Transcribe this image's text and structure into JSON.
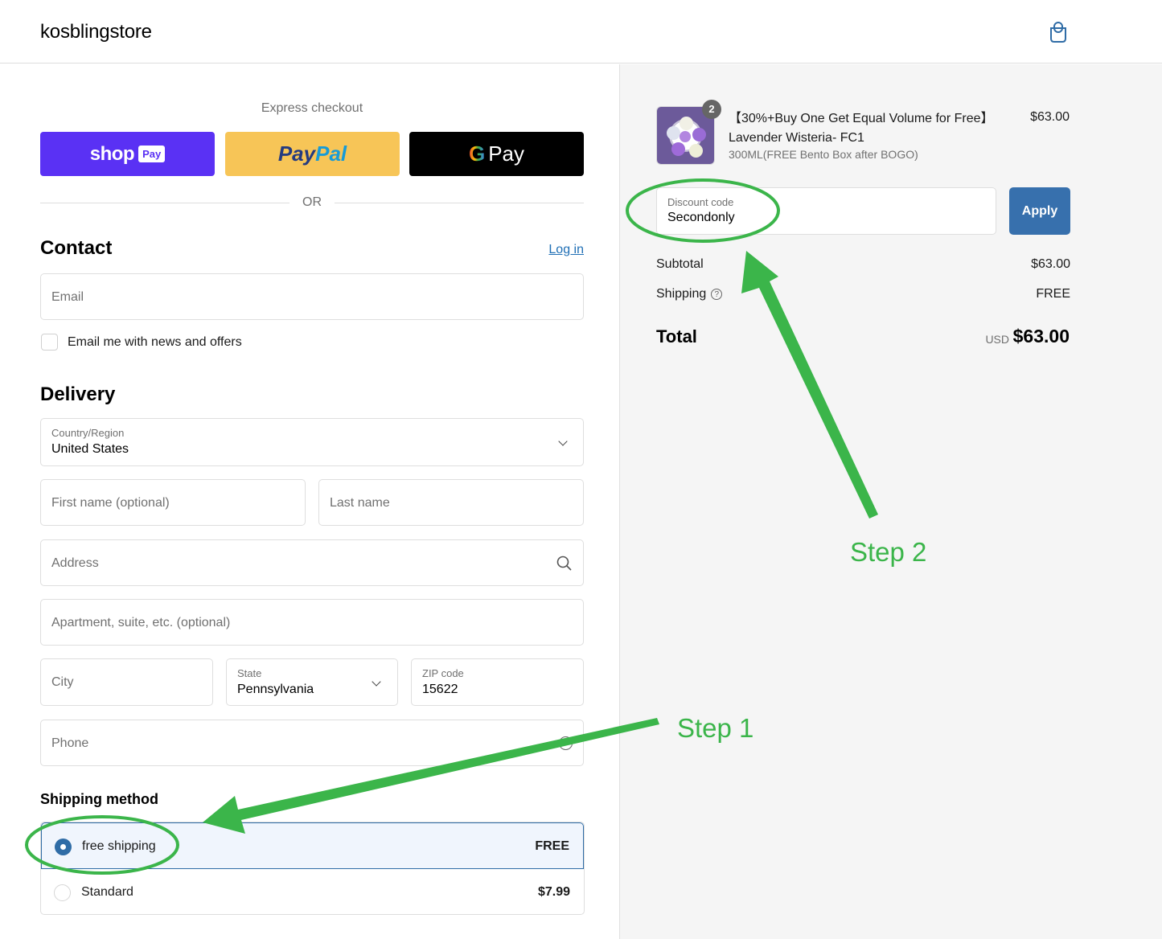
{
  "header": {
    "brand": "kosblingstore",
    "cart_icon": "shopping-bag-icon",
    "accent_color": "#2f6ca6"
  },
  "express": {
    "label": "Express checkout",
    "shop_pay": {
      "word": "shop",
      "badge": "Pay",
      "color": "#5a31f4"
    },
    "paypal": {
      "part1": "Pay",
      "part2": "Pal",
      "color": "#f7c557"
    },
    "gpay": {
      "g": "G",
      "word": "Pay",
      "color": "#000000"
    },
    "divider": "OR"
  },
  "contact": {
    "title": "Contact",
    "login_link": "Log in",
    "email": {
      "placeholder": "Email",
      "value": ""
    },
    "newsletter": {
      "label": "Email me with news and offers",
      "checked": false
    }
  },
  "delivery": {
    "title": "Delivery",
    "country": {
      "label": "Country/Region",
      "value": "United States"
    },
    "first_name": {
      "placeholder": "First name (optional)",
      "value": ""
    },
    "last_name": {
      "placeholder": "Last name",
      "value": ""
    },
    "address": {
      "placeholder": "Address",
      "value": ""
    },
    "apartment": {
      "placeholder": "Apartment, suite, etc. (optional)",
      "value": ""
    },
    "city": {
      "placeholder": "City",
      "value": ""
    },
    "state": {
      "label": "State",
      "value": "Pennsylvania"
    },
    "zip": {
      "label": "ZIP code",
      "value": "15622"
    },
    "phone": {
      "placeholder": "Phone",
      "value": ""
    }
  },
  "shipping_method": {
    "title": "Shipping method",
    "options": [
      {
        "name": "free shipping",
        "price": "FREE",
        "selected": true
      },
      {
        "name": "Standard",
        "price": "$7.99",
        "selected": false
      }
    ]
  },
  "summary": {
    "item": {
      "quantity": "2",
      "title": "【30%+Buy One Get Equal Volume for Free】Lavender Wisteria- FC1",
      "variant": "300ML(FREE Bento Box after BOGO)",
      "price": "$63.00"
    },
    "discount": {
      "label": "Discount code",
      "value": "Secondonly",
      "apply_label": "Apply"
    },
    "subtotal_label": "Subtotal",
    "subtotal": "$63.00",
    "shipping_label": "Shipping",
    "shipping": "FREE",
    "total_label": "Total",
    "currency": "USD",
    "total": "$63.00"
  },
  "annotations": {
    "step1": "Step 1",
    "step2": "Step 2",
    "color": "#3bb54a"
  }
}
